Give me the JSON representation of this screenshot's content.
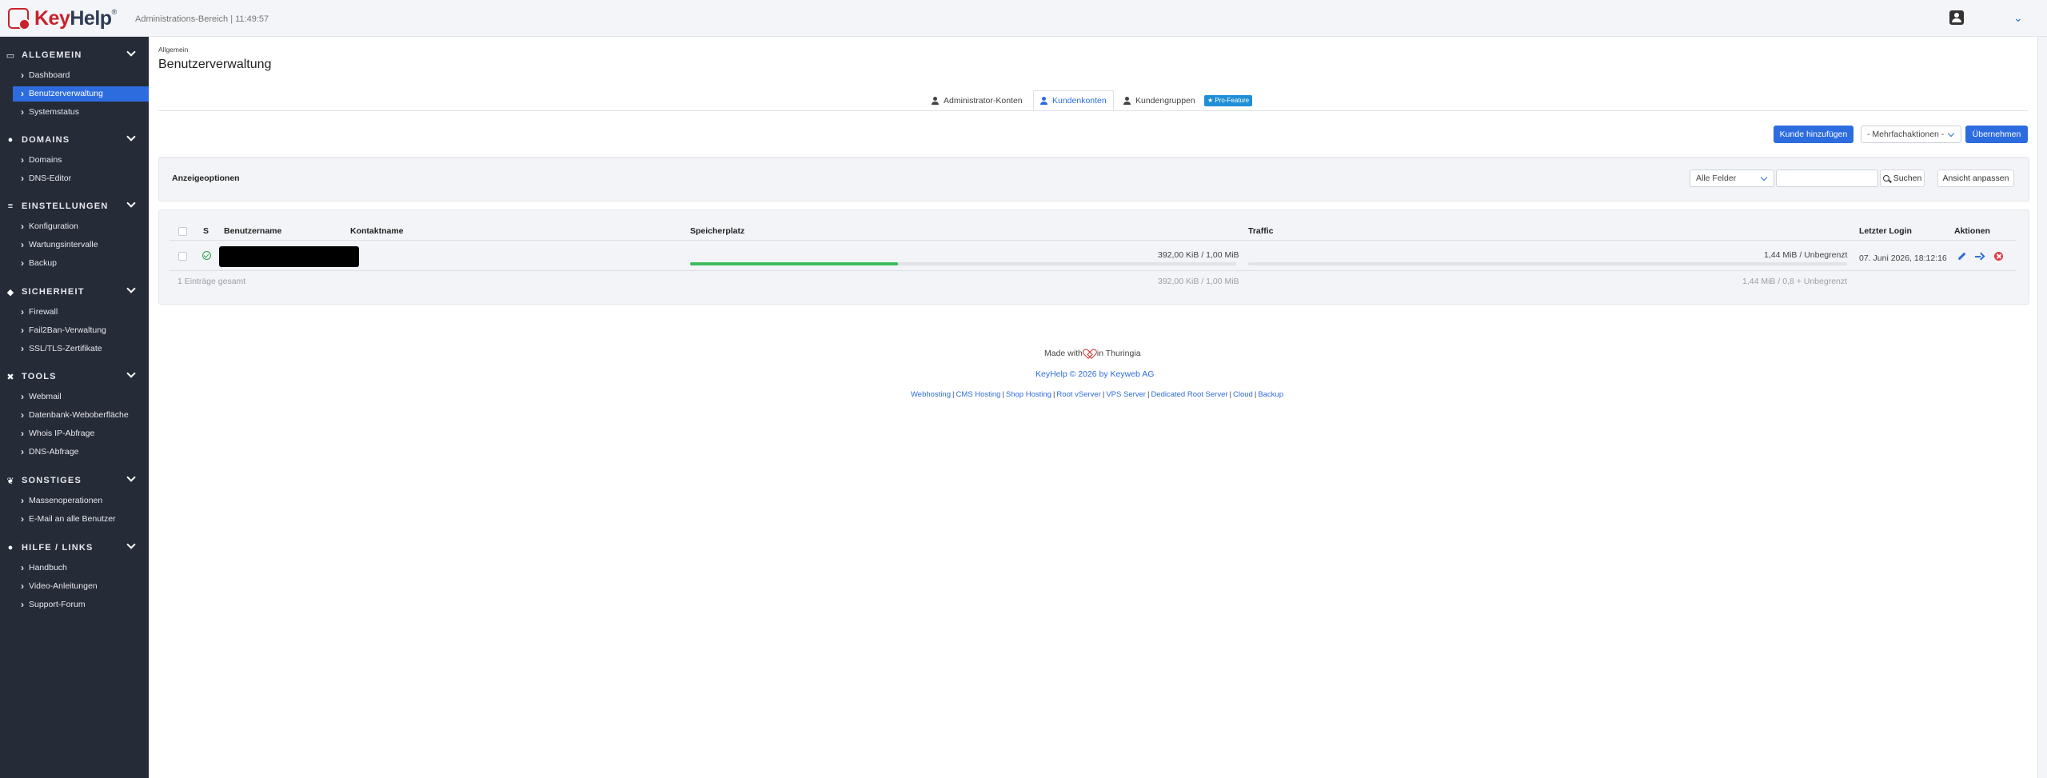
{
  "header": {
    "logo_text_key": "Key",
    "logo_text_help": "Help",
    "logo_reg": "®",
    "subtitle": "Administrations-Bereich | 11:49:57"
  },
  "sidebar": {
    "sections": [
      {
        "label": "ALLGEMEIN",
        "icon": "monitor-icon",
        "items": [
          "Dashboard",
          "Benutzerverwaltung",
          "Systemstatus"
        ]
      },
      {
        "label": "DOMAINS",
        "icon": "globe-icon",
        "items": [
          "Domains",
          "DNS-Editor"
        ]
      },
      {
        "label": "EINSTELLUNGEN",
        "icon": "sliders-icon",
        "items": [
          "Konfiguration",
          "Wartungsintervalle",
          "Backup"
        ]
      },
      {
        "label": "SICHERHEIT",
        "icon": "shield-icon",
        "items": [
          "Firewall",
          "Fail2Ban-Verwaltung",
          "SSL/TLS-Zertifikate"
        ]
      },
      {
        "label": "TOOLS",
        "icon": "tools-icon",
        "items": [
          "Webmail",
          "Datenbank-Weboberfläche",
          "Whois IP-Abfrage",
          "DNS-Abfrage"
        ]
      },
      {
        "label": "SONSTIGES",
        "icon": "leaf-icon",
        "items": [
          "Massenoperationen",
          "E-Mail an alle Benutzer"
        ]
      },
      {
        "label": "HILFE / LINKS",
        "icon": "info-icon",
        "items": [
          "Handbuch",
          "Video-Anleitungen",
          "Support-Forum"
        ]
      }
    ],
    "active_item": "Benutzerverwaltung"
  },
  "main": {
    "breadcrumb": "Allgemein",
    "title": "Benutzerverwaltung",
    "tabs": [
      {
        "label": "Administrator-Konten"
      },
      {
        "label": "Kundenkonten"
      },
      {
        "label": "Kundengruppen"
      }
    ],
    "pro_badge": "Pro-Feature",
    "add_button": "Kunde hinzufügen",
    "bulk_select": "- Mehrfachaktionen -",
    "apply_button": "Übernehmen",
    "options_title": "Anzeigeoptionen",
    "field_select": "Alle Felder",
    "search_button": "Suchen",
    "customize_button": "Ansicht anpassen"
  },
  "table": {
    "headers": {
      "status": "S",
      "username": "Benutzername",
      "contact": "Kontaktname",
      "storage": "Speicherplatz",
      "traffic": "Traffic",
      "last_login": "Letzter Login",
      "actions": "Aktionen"
    },
    "rows": [
      {
        "storage_text": "392,00 KiB / 1,00 MiB",
        "storage_fraction": 0.38,
        "traffic_text": "1,44 MiB / Unbegrenzt",
        "traffic_fraction": 0,
        "last_login": "07. Juni 2026, 18:12:16"
      }
    ],
    "summary_count": "1 Einträge gesamt",
    "summary_storage": "392,00 KiB / 1,00 MiB",
    "summary_traffic": "1,44 MiB / 0,8 + Unbegrenzt"
  },
  "footer": {
    "made_with": "Made with",
    "in_thuringia": "in Thuringia",
    "copyright": "KeyHelp © 2026 by Keyweb AG",
    "links": [
      "Webhosting",
      "CMS Hosting",
      "Shop Hosting",
      "Root vServer",
      "VPS Server",
      "Dedicated Root Server",
      "Cloud",
      "Backup"
    ]
  },
  "colors": {
    "accent": "#2d6cdf",
    "sidebar_bg": "#262b38",
    "brand_red": "#c8232c",
    "success": "#3fbb5d",
    "danger": "#e23b4a"
  }
}
